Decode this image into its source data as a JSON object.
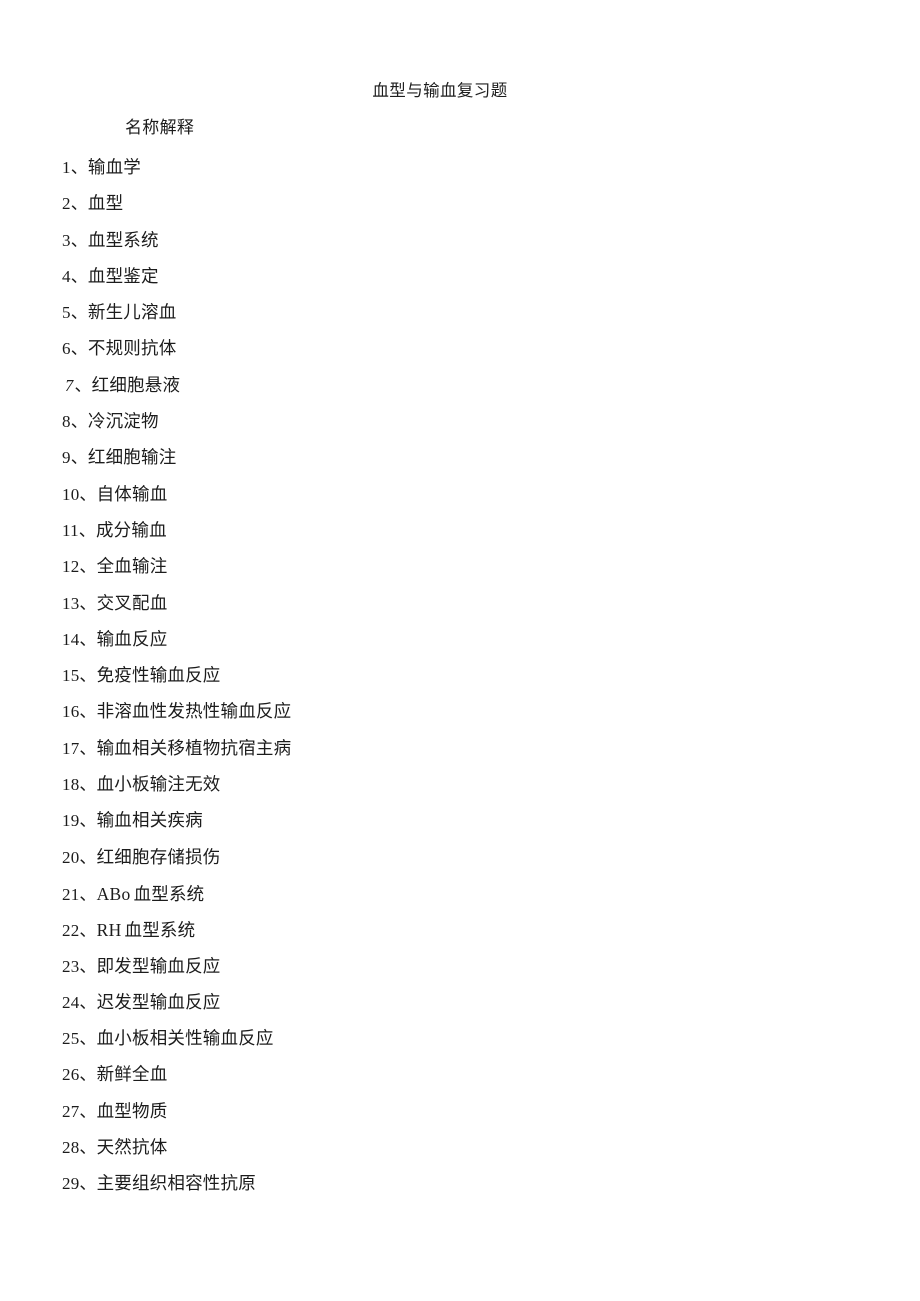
{
  "document": {
    "title": "血型与输血复习题",
    "section_heading": "名称解释",
    "background_color": "#ffffff",
    "text_color": "#1c1c1c"
  },
  "terms": [
    {
      "number": "1",
      "separator": "、",
      "text": "输血学"
    },
    {
      "number": "2",
      "separator": "、",
      "text": "血型"
    },
    {
      "number": "3",
      "separator": "、",
      "text": "血型系统"
    },
    {
      "number": "4",
      "separator": "、",
      "text": "血型鉴定"
    },
    {
      "number": "5",
      "separator": "、",
      "text": "新生儿溶血"
    },
    {
      "number": "6",
      "separator": "、",
      "text": "不规则抗体"
    },
    {
      "number": "7",
      "separator": "、",
      "text": "红细胞悬液"
    },
    {
      "number": "8",
      "separator": "、",
      "text": "冷沉淀物"
    },
    {
      "number": "9",
      "separator": "、",
      "text": "红细胞输注"
    },
    {
      "number": "10",
      "separator": "、",
      "text": "自体输血"
    },
    {
      "number": "11",
      "separator": "、",
      "text": "成分输血"
    },
    {
      "number": "12",
      "separator": "、",
      "text": "全血输注"
    },
    {
      "number": "13",
      "separator": "、",
      "text": "交叉配血"
    },
    {
      "number": "14",
      "separator": "、",
      "text": "输血反应"
    },
    {
      "number": "15",
      "separator": "、",
      "text": "免疫性输血反应"
    },
    {
      "number": "16",
      "separator": "、",
      "text": "非溶血性发热性输血反应"
    },
    {
      "number": "17",
      "separator": "、",
      "text": "输血相关移植物抗宿主病"
    },
    {
      "number": "18",
      "separator": "、",
      "text": "血小板输注无效"
    },
    {
      "number": "19",
      "separator": "、",
      "text": "输血相关疾病"
    },
    {
      "number": "20",
      "separator": "、",
      "text": "红细胞存储损伤"
    },
    {
      "number": "21",
      "separator": "、",
      "latin": "ABo",
      "text": "血型系统"
    },
    {
      "number": "22",
      "separator": "、",
      "latin": "RH",
      "text": "血型系统"
    },
    {
      "number": "23",
      "separator": "、",
      "text": "即发型输血反应"
    },
    {
      "number": "24",
      "separator": "、",
      "text": "迟发型输血反应"
    },
    {
      "number": "25",
      "separator": "、",
      "text": "血小板相关性输血反应"
    },
    {
      "number": "26",
      "separator": "、",
      "text": "新鲜全血"
    },
    {
      "number": "27",
      "separator": "、",
      "text": "血型物质"
    },
    {
      "number": "28",
      "separator": "、",
      "text": "天然抗体"
    },
    {
      "number": "29",
      "separator": "、",
      "text": "主要组织相容性抗原"
    }
  ]
}
